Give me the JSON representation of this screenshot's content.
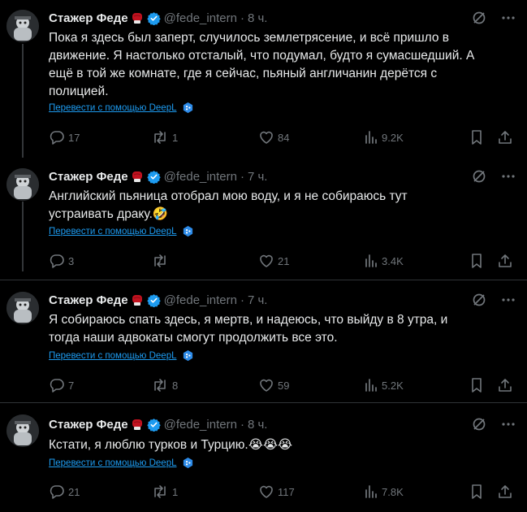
{
  "translate_label": "Перевести с помощью DeepL",
  "colors": {
    "background": "#000000",
    "text": "#e7e9ea",
    "muted": "#71767b",
    "link": "#1d9bf0",
    "divider": "#2f3336",
    "glove": "#c1121f"
  },
  "icons": {
    "more": "more-dots-icon",
    "grok": "grok-icon",
    "reply": "reply-icon",
    "retweet": "retweet-icon",
    "like": "heart-icon",
    "views": "views-bars-icon",
    "bookmark": "bookmark-icon",
    "share": "share-icon",
    "verified": "verified-badge-icon",
    "glove": "boxing-glove-icon",
    "deepl": "deepl-icon"
  },
  "tweets": [
    {
      "name": "Стажер Феде",
      "handle": "@fede_intern",
      "sep": "·",
      "time": "8 ч.",
      "lines": [
        "Пока я здесь был заперт, случилось землетрясение, и всё пришло в",
        "движение. Я настолько отсталый, что подумал, будто я сумасшедший. А",
        "ещё в той же комнате, где я сейчас, пьяный англичанин дерётся с",
        "полицией."
      ],
      "emoji": "",
      "replies": "17",
      "retweets": "1",
      "likes": "84",
      "views": "9.2K"
    },
    {
      "name": "Стажер Феде",
      "handle": "@fede_intern",
      "sep": "·",
      "time": "7 ч.",
      "lines": [
        "Английский пьяница отобрал мою воду, и я не собираюсь тут",
        "устраивать драку."
      ],
      "emoji": "🤣",
      "replies": "3",
      "retweets": "",
      "likes": "21",
      "views": "3.4K"
    },
    {
      "name": "Стажер Феде",
      "handle": "@fede_intern",
      "sep": "·",
      "time": "7 ч.",
      "lines": [
        "Я собираюсь спать здесь, я мертв, и надеюсь, что выйду в 8 утра, и",
        "тогда наши адвокаты смогут продолжить все это."
      ],
      "emoji": "",
      "replies": "7",
      "retweets": "8",
      "likes": "59",
      "views": "5.2K"
    },
    {
      "name": "Стажер Феде",
      "handle": "@fede_intern",
      "sep": "·",
      "time": "8 ч.",
      "lines": [
        "Кстати, я люблю турков и Турцию."
      ],
      "emoji": "😭😭😭",
      "replies": "21",
      "retweets": "1",
      "likes": "117",
      "views": "7.8K"
    }
  ]
}
